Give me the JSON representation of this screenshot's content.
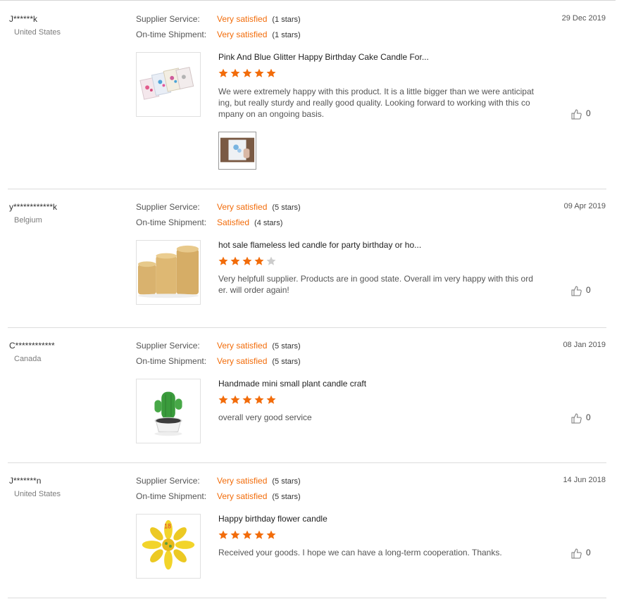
{
  "colors": {
    "accent": "#f26c0a",
    "divider": "#dcdcdc",
    "star_empty": "#cccccc"
  },
  "labels": {
    "supplier_service": "Supplier Service:",
    "ontime_shipment": "On-time Shipment:"
  },
  "reviews": [
    {
      "buyer": "J******k",
      "country": "United States",
      "date": "29 Dec 2019",
      "supplier_service": {
        "value": "Very satisfied",
        "stars": "(1 stars)"
      },
      "ontime_shipment": {
        "value": "Very satisfied",
        "stars": "(1 stars)"
      },
      "product_title": "Pink And Blue Glitter Happy Birthday Cake Candle For...",
      "product_image": "glitter-birthday-candles-photo",
      "rating": 5,
      "comment": "We were extremely happy with this product.  It is a little bigger than we were anticipating, but really sturdy and really good quality.  Looking forward to working with this company on an ongoing basis.",
      "helpful_count": "0",
      "attachment": "buyer-photo-candle-package"
    },
    {
      "buyer": "y************k",
      "country": "Belgium",
      "date": "09 Apr 2019",
      "supplier_service": {
        "value": "Very satisfied",
        "stars": "(5 stars)"
      },
      "ontime_shipment": {
        "value": "Satisfied",
        "stars": "(4 stars)"
      },
      "product_title": "hot sale flameless led candle for party birthday or ho...",
      "product_image": "flameless-led-candles-photo",
      "rating": 4,
      "comment": "Very helpfull supplier. Products are in good state. Overall im very happy with this order. will order again!",
      "helpful_count": "0"
    },
    {
      "buyer": "C************",
      "country": "Canada",
      "date": "08 Jan 2019",
      "supplier_service": {
        "value": "Very satisfied",
        "stars": "(5 stars)"
      },
      "ontime_shipment": {
        "value": "Very satisfied",
        "stars": "(5 stars)"
      },
      "product_title": "Handmade mini small plant candle craft",
      "product_image": "cactus-candle-photo",
      "rating": 5,
      "comment": "overall very good service",
      "helpful_count": "0"
    },
    {
      "buyer": "J*******n",
      "country": "United States",
      "date": "14 Jun 2018",
      "supplier_service": {
        "value": "Very satisfied",
        "stars": "(5 stars)"
      },
      "ontime_shipment": {
        "value": "Very satisfied",
        "stars": "(5 stars)"
      },
      "product_title": "Happy birthday flower candle",
      "product_image": "flower-candle-photo",
      "rating": 5,
      "comment": "Received your goods. I hope we can have a long-term cooperation. Thanks.",
      "helpful_count": "0"
    }
  ]
}
